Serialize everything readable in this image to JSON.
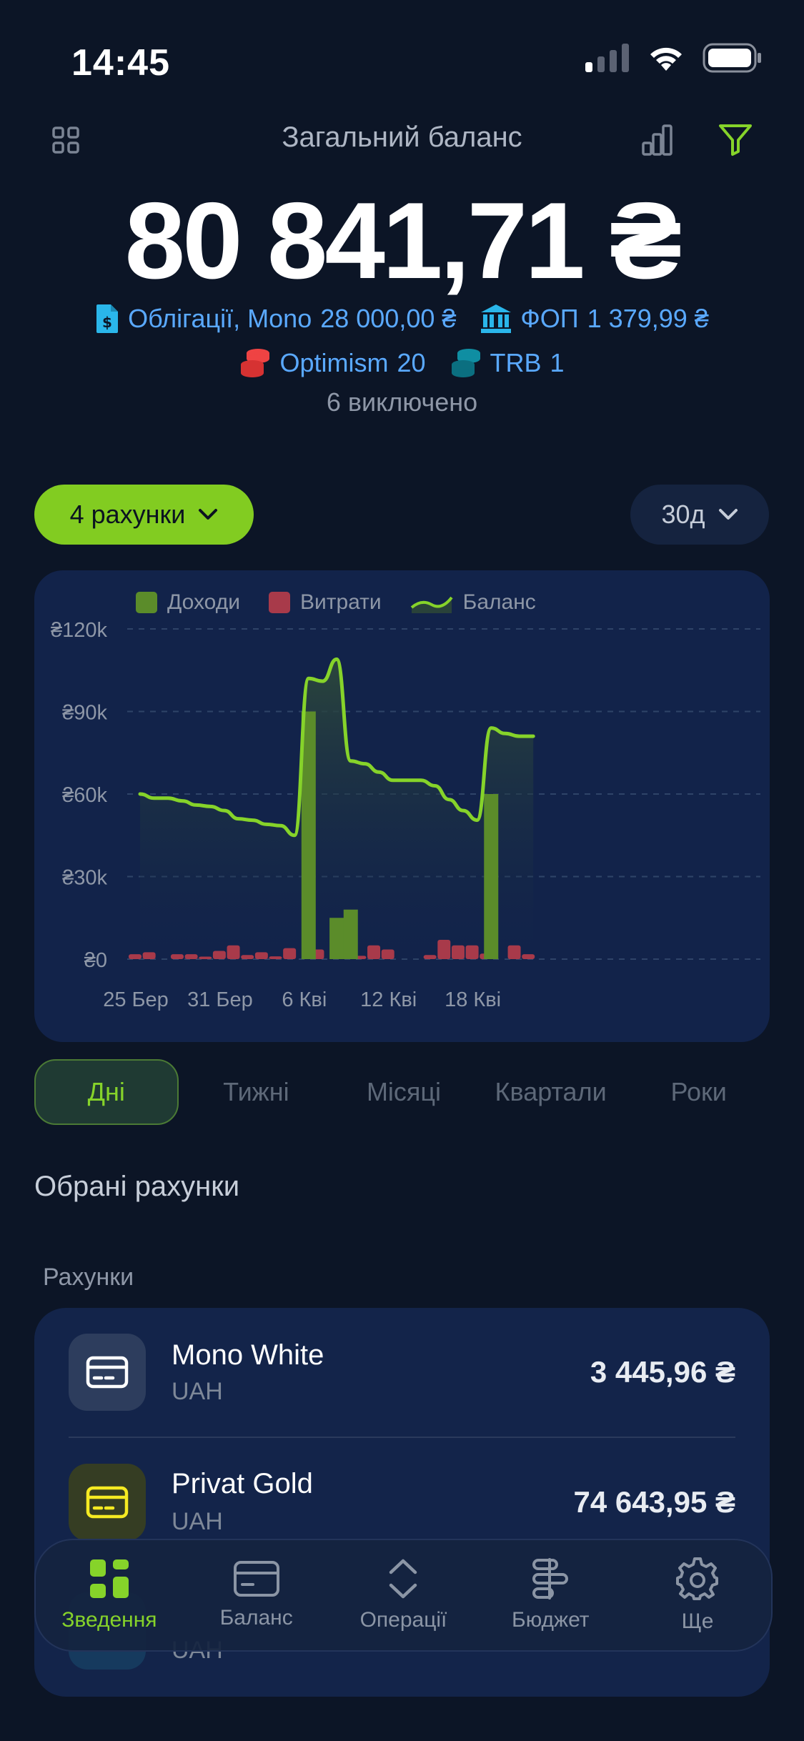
{
  "status_bar": {
    "time": "14:45"
  },
  "header": {
    "title": "Загальний баланс",
    "total": "80 841,71 ₴",
    "assets": [
      {
        "name": "Облігації, Mono",
        "amount": "28 000,00 ₴",
        "icon": "document-icon",
        "color": "#2ab6ea"
      },
      {
        "name": "ФОП",
        "amount": "1 379,99 ₴",
        "icon": "bank-icon",
        "color": "#2ab6ea"
      },
      {
        "name": "Optimism",
        "amount": "20",
        "icon": "coin-stack-red-icon",
        "color": "#ef4343"
      },
      {
        "name": "TRB",
        "amount": "1",
        "icon": "coin-stack-teal-icon",
        "color": "#0f8ea2"
      }
    ],
    "excluded": "6 виключено"
  },
  "filters": {
    "accounts": "4 рахунки",
    "period": "30д"
  },
  "chart_data": {
    "type": "bar",
    "legend": [
      "Доходи",
      "Витрати",
      "Баланс"
    ],
    "colors": {
      "income": "#5b8c2a",
      "expense": "#a83a4a",
      "balance": "#86d32a"
    },
    "y_ticks": [
      "₴0",
      "₴30k",
      "₴60k",
      "₴90k",
      "₴120k"
    ],
    "ylim": [
      0,
      120000
    ],
    "x_ticks": [
      {
        "label": "25 Бер",
        "day": 0
      },
      {
        "label": "31 Бер",
        "day": 6
      },
      {
        "label": "6 Кві",
        "day": 12
      },
      {
        "label": "12 Кві",
        "day": 18
      },
      {
        "label": "18 Кві",
        "day": 24
      }
    ],
    "income": [
      0,
      0,
      0,
      0,
      0,
      0,
      0,
      0,
      0,
      0,
      0,
      0,
      90000,
      0,
      15000,
      18000,
      0,
      0,
      0,
      0,
      0,
      0,
      0,
      0,
      0,
      60000,
      0,
      0,
      0
    ],
    "expenses": [
      1800,
      2500,
      0,
      1800,
      1800,
      900,
      3000,
      5000,
      1500,
      2500,
      1000,
      4000,
      0,
      3500,
      0,
      0,
      1200,
      5000,
      3500,
      0,
      0,
      1500,
      7000,
      5000,
      5000,
      2000,
      0,
      5000,
      1800
    ],
    "balance": [
      60000,
      58500,
      58500,
      57500,
      56000,
      55500,
      54000,
      51000,
      50500,
      49000,
      48500,
      45000,
      102000,
      101000,
      109000,
      72000,
      71000,
      68000,
      65000,
      65000,
      65000,
      63000,
      58000,
      54000,
      50500,
      84000,
      82000,
      81000,
      81000
    ]
  },
  "period_tabs": [
    "Дні",
    "Тижні",
    "Місяці",
    "Квартали",
    "Роки"
  ],
  "accounts_section": {
    "title": "Обрані рахунки",
    "label": "Рахунки",
    "items": [
      {
        "name": "Mono White",
        "currency": "UAH",
        "amount": "3 445,96 ₴",
        "icon_bg": "#2d3d5d",
        "icon_color": "#ffffff"
      },
      {
        "name": "Privat Gold",
        "currency": "UAH",
        "amount": "74 643,95 ₴",
        "icon_bg": "#353d23",
        "icon_color": "#f5ea22"
      },
      {
        "currency": "UAH"
      }
    ]
  },
  "nav": [
    "Зведення",
    "Баланс",
    "Операції",
    "Бюджет",
    "Ще"
  ]
}
